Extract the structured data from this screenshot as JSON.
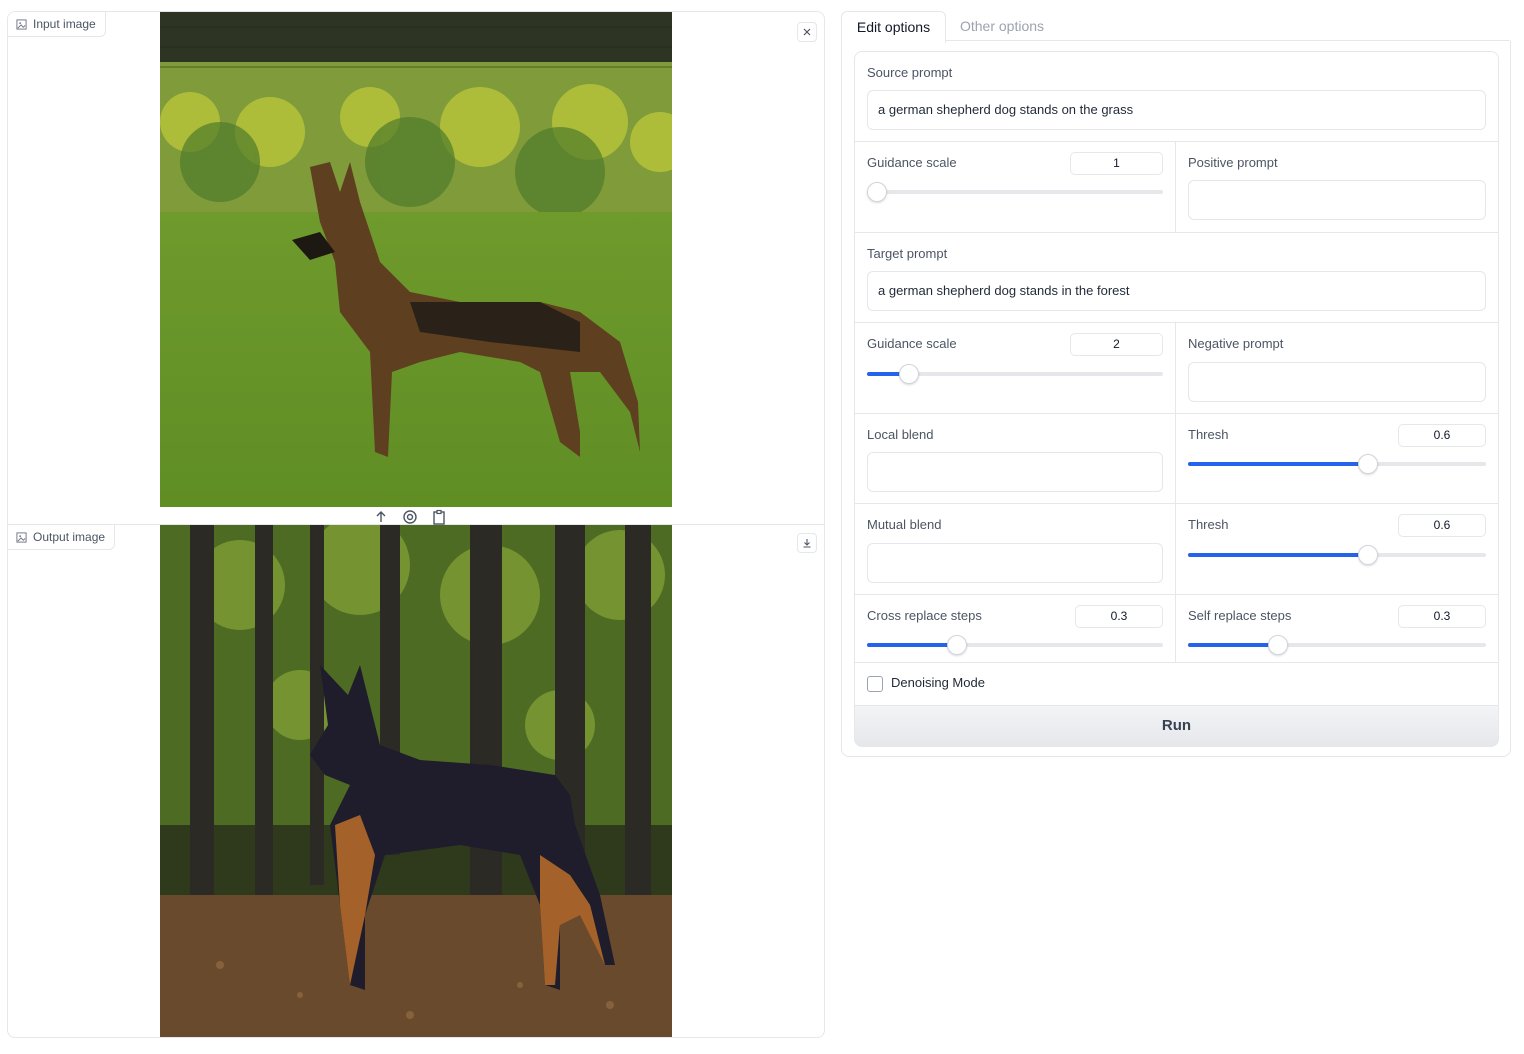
{
  "input_image": {
    "label": "Input image",
    "close_icon": "close-icon",
    "toolbar_icons": [
      "upload-icon",
      "webcam-icon",
      "clipboard-icon"
    ]
  },
  "output_image": {
    "label": "Output image",
    "download_icon": "download-icon"
  },
  "tabs": [
    {
      "label": "Edit options",
      "active": true
    },
    {
      "label": "Other options",
      "active": false
    }
  ],
  "form": {
    "source_prompt": {
      "label": "Source prompt",
      "value": "a german shepherd dog stands on the grass"
    },
    "source_guidance": {
      "label": "Guidance scale",
      "value": "1",
      "fraction": 0.0
    },
    "positive_prompt": {
      "label": "Positive prompt",
      "value": ""
    },
    "target_prompt": {
      "label": "Target prompt",
      "value": "a german shepherd dog stands in the forest"
    },
    "target_guidance": {
      "label": "Guidance scale",
      "value": "2",
      "fraction": 0.14
    },
    "negative_prompt": {
      "label": "Negative prompt",
      "value": ""
    },
    "local_blend": {
      "label": "Local blend",
      "value": ""
    },
    "local_thresh": {
      "label": "Thresh",
      "value": "0.6",
      "fraction": 0.6
    },
    "mutual_blend": {
      "label": "Mutual blend",
      "value": ""
    },
    "mutual_thresh": {
      "label": "Thresh",
      "value": "0.6",
      "fraction": 0.6
    },
    "cross_replace": {
      "label": "Cross replace steps",
      "value": "0.3",
      "fraction": 0.3
    },
    "self_replace": {
      "label": "Self replace steps",
      "value": "0.3",
      "fraction": 0.3
    },
    "denoising": {
      "label": "Denoising Mode",
      "checked": false
    },
    "run_label": "Run"
  },
  "colors": {
    "accent": "#2563eb",
    "border": "#e5e7eb",
    "run_bg": "#e5e7eb"
  }
}
